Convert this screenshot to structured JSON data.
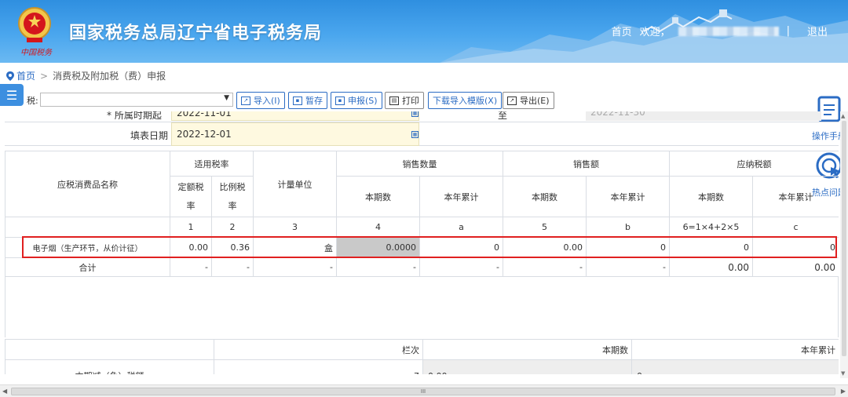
{
  "header": {
    "site_title": "国家税务总局辽宁省电子税务局",
    "emblem_text": "中国税务",
    "nav_home": "首页",
    "nav_welcome": "欢迎，",
    "nav_sep": "|",
    "nav_logout": "退出"
  },
  "breadcrumb": {
    "home": "首页",
    "sep": ">",
    "current": "消费税及附加税（费）申报"
  },
  "toolbar": {
    "tax_label": "税:",
    "tax_select_value": "",
    "import": "导入(I)",
    "save_draft": "暂存",
    "submit": "申报(S)",
    "print": "打印",
    "download_template": "下载导入模版(X)",
    "export": "导出(E)"
  },
  "side_tools": {
    "manual": "操作手册",
    "faq": "热点问题"
  },
  "form": {
    "period_label": "* 所属时期起",
    "period_start": "2022-11-01",
    "period_to": "至",
    "period_end": "2022-11-30",
    "fill_date_label": "填表日期",
    "fill_date": "2022-12-01"
  },
  "table": {
    "headers": {
      "name": "应税消费品名称",
      "rate_group": "适用税率",
      "fixed_rate_line1": "定额税",
      "fixed_rate_line2": "率",
      "ratio_rate_line1": "比例税",
      "ratio_rate_line2": "率",
      "unit": "计量单位",
      "qty_group": "销售数量",
      "amount_group": "销售额",
      "tax_group": "应纳税额",
      "current": "本期数",
      "ytd": "本年累计"
    },
    "col_codes": [
      "1",
      "2",
      "3",
      "4",
      "a",
      "5",
      "b",
      "6=1×4+2×5",
      "c"
    ],
    "rows": [
      {
        "name": "电子烟（生产环节，从价计征）",
        "fixed_rate": "0.00",
        "ratio_rate": "0.36",
        "unit": "盒",
        "qty_current": "0.0000",
        "qty_ytd": "0",
        "amount_current": "0.00",
        "amount_ytd": "0",
        "tax_current": "0",
        "tax_ytd": "0"
      },
      {
        "name": "合计",
        "fixed_rate": "-",
        "ratio_rate": "-",
        "unit": "-",
        "qty_current": "-",
        "qty_ytd": "-",
        "amount_current": "-",
        "amount_ytd": "-",
        "tax_current": "0.00",
        "tax_ytd": "0.00"
      }
    ]
  },
  "lower_table": {
    "col_line": "栏次",
    "col_current": "本期数",
    "col_ytd": "本年累计",
    "row_label": "本期减（免）税额",
    "row_line": "7",
    "row_current": "0.00",
    "row_ytd": "0"
  },
  "scrollbar": {
    "grip": "III"
  }
}
